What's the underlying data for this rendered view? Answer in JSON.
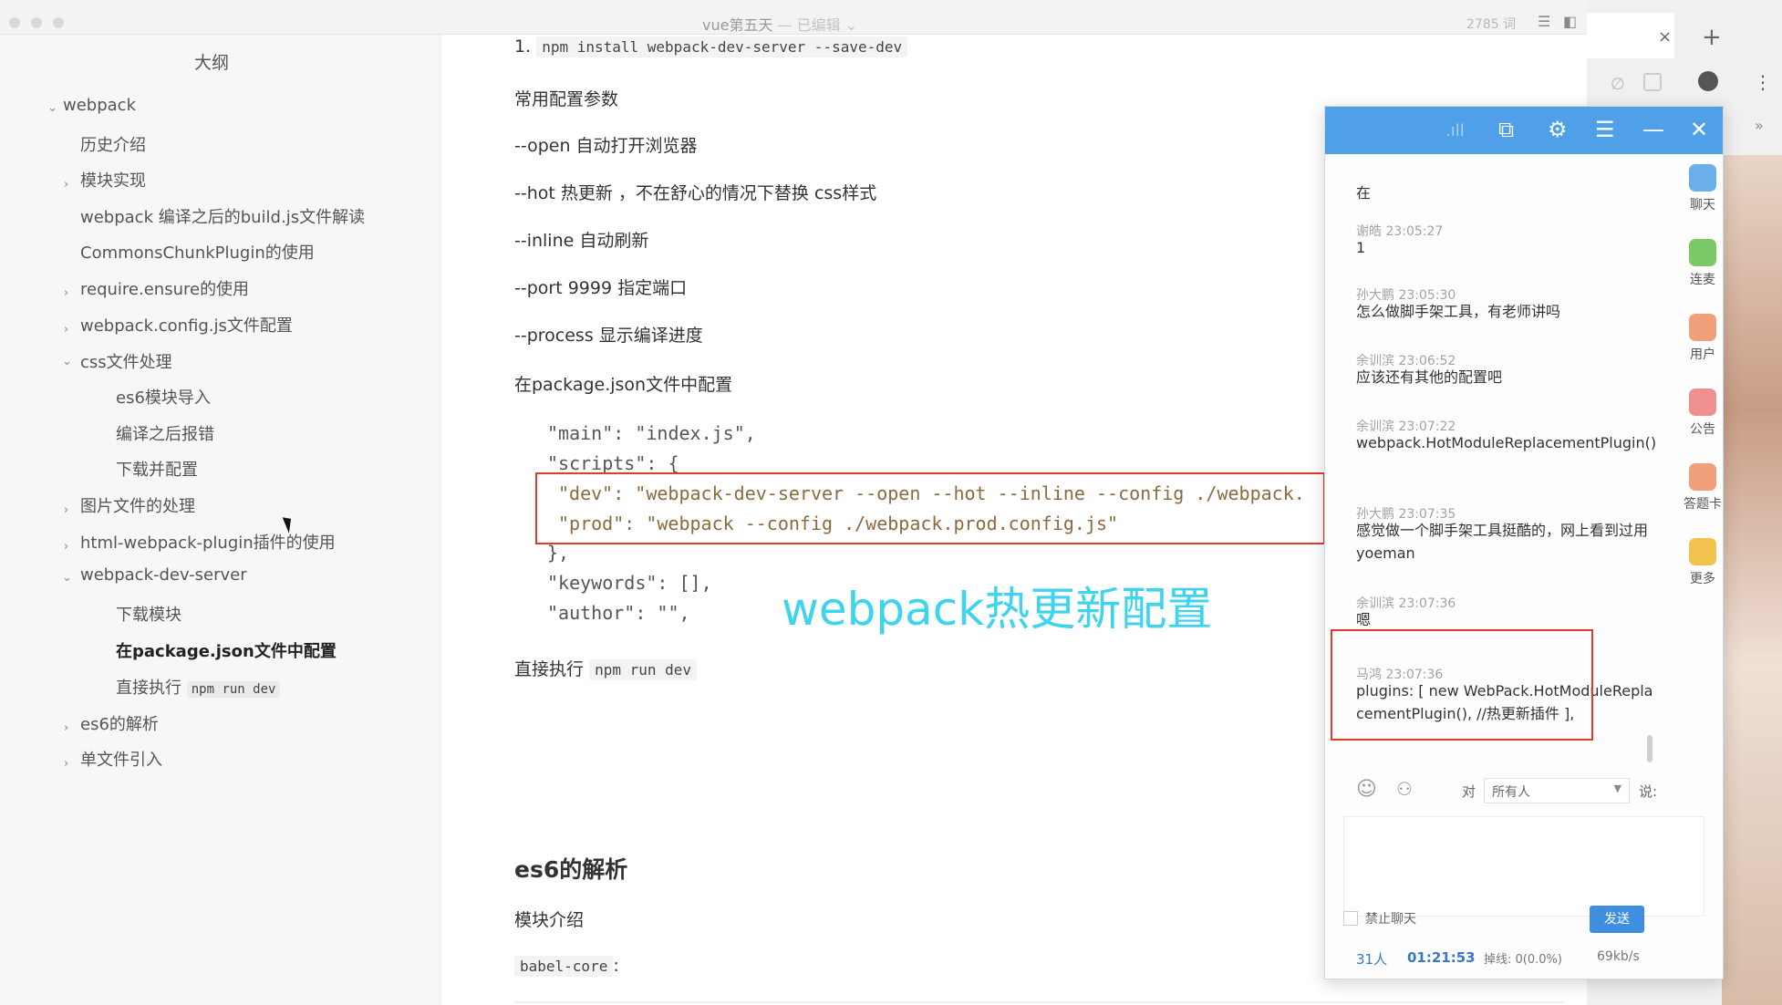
{
  "window": {
    "title": "vue第五天",
    "title_suffix": "— 已编辑 ⌄",
    "word_count": "2785 词"
  },
  "sidebar": {
    "title": "大纲",
    "items": [
      {
        "label": "webpack",
        "chev": "⌄"
      },
      {
        "label": "历史介绍",
        "chev": ""
      },
      {
        "label": "模块实现",
        "chev": "›"
      },
      {
        "label": "webpack 编译之后的build.js文件解读",
        "chev": ""
      },
      {
        "label": "CommonsChunkPlugin的使用",
        "chev": ""
      },
      {
        "label": "require.ensure的使用",
        "chev": "›"
      },
      {
        "label": "webpack.config.js文件配置",
        "chev": "›"
      },
      {
        "label": "css文件处理",
        "chev": "⌄"
      },
      {
        "label": "es6模块导入",
        "chev": ""
      },
      {
        "label": "编译之后报错",
        "chev": ""
      },
      {
        "label": "下载并配置",
        "chev": ""
      },
      {
        "label": "图片文件的处理",
        "chev": "›"
      },
      {
        "label": "html-webpack-plugin插件的使用",
        "chev": "›"
      },
      {
        "label": "webpack-dev-server",
        "chev": "⌄"
      },
      {
        "label": "下载模块",
        "chev": ""
      },
      {
        "label": "在package.json文件中配置",
        "chev": ""
      },
      {
        "label": "直接执行",
        "code": "npm run dev",
        "chev": ""
      },
      {
        "label": "es6的解析",
        "chev": "›"
      },
      {
        "label": "单文件引入",
        "chev": "›"
      }
    ]
  },
  "doc": {
    "install_num": "1.",
    "install_cmd": "npm install webpack-dev-server --save-dev",
    "params_title": "常用配置参数",
    "params": [
      "--open 自动打开浏览器",
      "--hot 热更新 ，不在舒心的情况下替换 css样式",
      "--inline  自动刷新",
      "--port 9999 指定端口",
      "--process 显示编译进度"
    ],
    "config_in_pkg": "在package.json文件中配置",
    "code_lines": {
      "main": "\"main\": \"index.js\",",
      "scripts": "\"scripts\": {",
      "dev": "\"dev\": \"webpack-dev-server --open --hot --inline --config ./webpack.",
      "prod": "\"prod\": \"webpack --config ./webpack.prod.config.js\"",
      "close": "},",
      "keywords": "\"keywords\": [],",
      "author": "\"author\": \"\","
    },
    "run_label": "直接执行",
    "run_cmd": "npm run dev",
    "es6_heading": "es6的解析",
    "module_intro": "模块介绍",
    "babel_core": "babel-core",
    "babel_colon": ":"
  },
  "overlay_title": "webpack热更新配置",
  "browser": {
    "close": "×",
    "new_tab": "+"
  },
  "chat": {
    "messages": [
      {
        "name": "",
        "text": "在"
      },
      {
        "name": "谢皓 23:05:27",
        "text": "1"
      },
      {
        "name": "孙大鹏 23:05:30",
        "text": "怎么做脚手架工具，有老师讲吗"
      },
      {
        "name": "余训滨 23:06:52",
        "text": "应该还有其他的配置吧"
      },
      {
        "name": "余训滨 23:07:22",
        "text": "webpack.HotModuleReplacementPlugin()"
      },
      {
        "name": "孙大鹏 23:07:35",
        "text": "感觉做一个脚手架工具挺酷的，网上看到过用yoeman"
      },
      {
        "name": "余训滨 23:07:36",
        "text": "嗯"
      },
      {
        "name": "马鸿 23:07:36",
        "text": "plugins: [        new WebPack.HotModuleReplacementPlugin(), //热更新插件    ],"
      }
    ],
    "rail": [
      {
        "label": "聊天",
        "color": "#6aaeea"
      },
      {
        "label": "连麦",
        "color": "#7cc96a"
      },
      {
        "label": "用户",
        "color": "#f0a07a"
      },
      {
        "label": "公告",
        "color": "#ef8f8f"
      },
      {
        "label": "答题卡",
        "color": "#f0a07a"
      },
      {
        "label": "更多",
        "color": "#f2c24f"
      }
    ],
    "to_label": "对",
    "to_value": "所有人",
    "say_label": "说:",
    "mute_label": "禁止聊天",
    "send_label": "发送",
    "stats": {
      "users": "31人",
      "time": "01:21:53",
      "drop": "掉线: 0(0.0%)",
      "speed": "69kb/s"
    }
  }
}
